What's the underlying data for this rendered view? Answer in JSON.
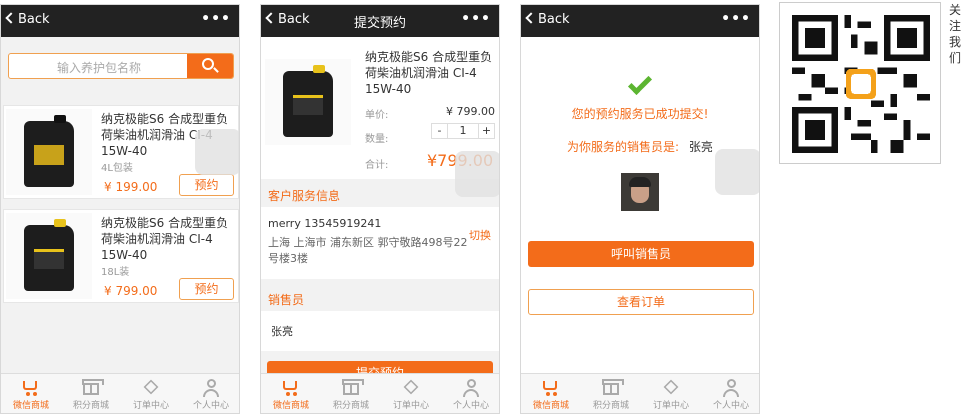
{
  "screen1": {
    "back_label": "Back",
    "menu_dots": "•••",
    "search_placeholder": "输入养护包名称",
    "products": [
      {
        "name": "纳克极能S6 合成型重负荷柴油机润滑油 CI-4 15W-40",
        "pack": "4L包装",
        "price": "¥ 199.00",
        "book_label": "预约"
      },
      {
        "name": "纳克极能S6 合成型重负荷柴油机润滑油 CI-4 15W-40",
        "pack": "18L装",
        "price": "¥ 799.00",
        "book_label": "预约"
      }
    ]
  },
  "screen2": {
    "back_label": "Back",
    "title": "提交预约",
    "menu_dots": "•••",
    "product_name": "纳克极能S6 合成型重负荷柴油机润滑油 CI-4 15W-40",
    "unit_price_label": "单价:",
    "unit_price": "¥ 799.00",
    "qty_label": "数量:",
    "qty_minus": "-",
    "qty_value": "1",
    "qty_plus": "+",
    "total_label": "合计:",
    "total_value": "¥799.00",
    "customer_header": "客户服务信息",
    "customer_name_phone": "merry 13545919241",
    "customer_address": "上海 上海市 浦东新区 郭守敬路498号22号楼3楼",
    "switch_label": "切换",
    "salesperson_header": "销售员",
    "salesperson_name": "张亮",
    "submit_label": "提交预约"
  },
  "screen3": {
    "back_label": "Back",
    "menu_dots": "•••",
    "success_message": "您的预约服务已成功提交!",
    "salesperson_prefix": "为你服务的销售员是:",
    "salesperson_name": "张亮",
    "call_button": "呼叫销售员",
    "view_order_button": "查看订单"
  },
  "tabbar": {
    "tabs": [
      "微信商城",
      "积分商城",
      "订单中心",
      "个人中心"
    ]
  },
  "side": {
    "follow_label": "关注我们"
  },
  "colors": {
    "accent": "#f36c1a",
    "topbar": "#222222",
    "check": "#5cb531"
  }
}
